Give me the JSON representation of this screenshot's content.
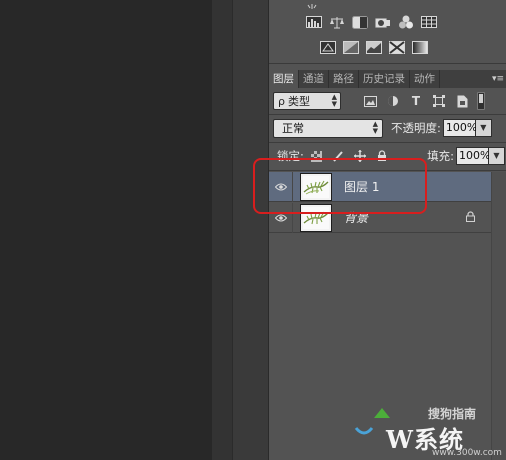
{
  "tabs": [
    {
      "label": "图层",
      "active": true
    },
    {
      "label": "通道",
      "active": false
    },
    {
      "label": "路径",
      "active": false
    },
    {
      "label": "历史记录",
      "active": false
    },
    {
      "label": "动作",
      "active": false
    }
  ],
  "tab_menu_icon": "panel-menu-icon",
  "filter": {
    "kind_prefix": "ρ",
    "kind_label": "类型",
    "filter_icons": [
      "pixel-filter-icon",
      "adjustment-filter-icon",
      "type-filter-icon",
      "shape-filter-icon",
      "smart-object-filter-icon"
    ],
    "type_glyph": "T"
  },
  "blend": {
    "mode": "正常",
    "opacity_label": "不透明度:",
    "opacity_value": "100%",
    "lock_label": "锁定:",
    "fill_label": "填充:",
    "fill_value": "100%"
  },
  "layers": [
    {
      "name": "图层 1",
      "visible": true,
      "selected": true,
      "locked": false
    },
    {
      "name": "背景",
      "visible": true,
      "selected": false,
      "locked": true
    }
  ],
  "watermark": {
    "line1": "搜狗指南",
    "line2": "W系统",
    "line3": "www.300w.com"
  },
  "colors": {
    "panel": "#535353",
    "selected_layer": "#5f6b7f",
    "annotation": "#d81e1e",
    "tab_bar": "#3f3f3f"
  }
}
